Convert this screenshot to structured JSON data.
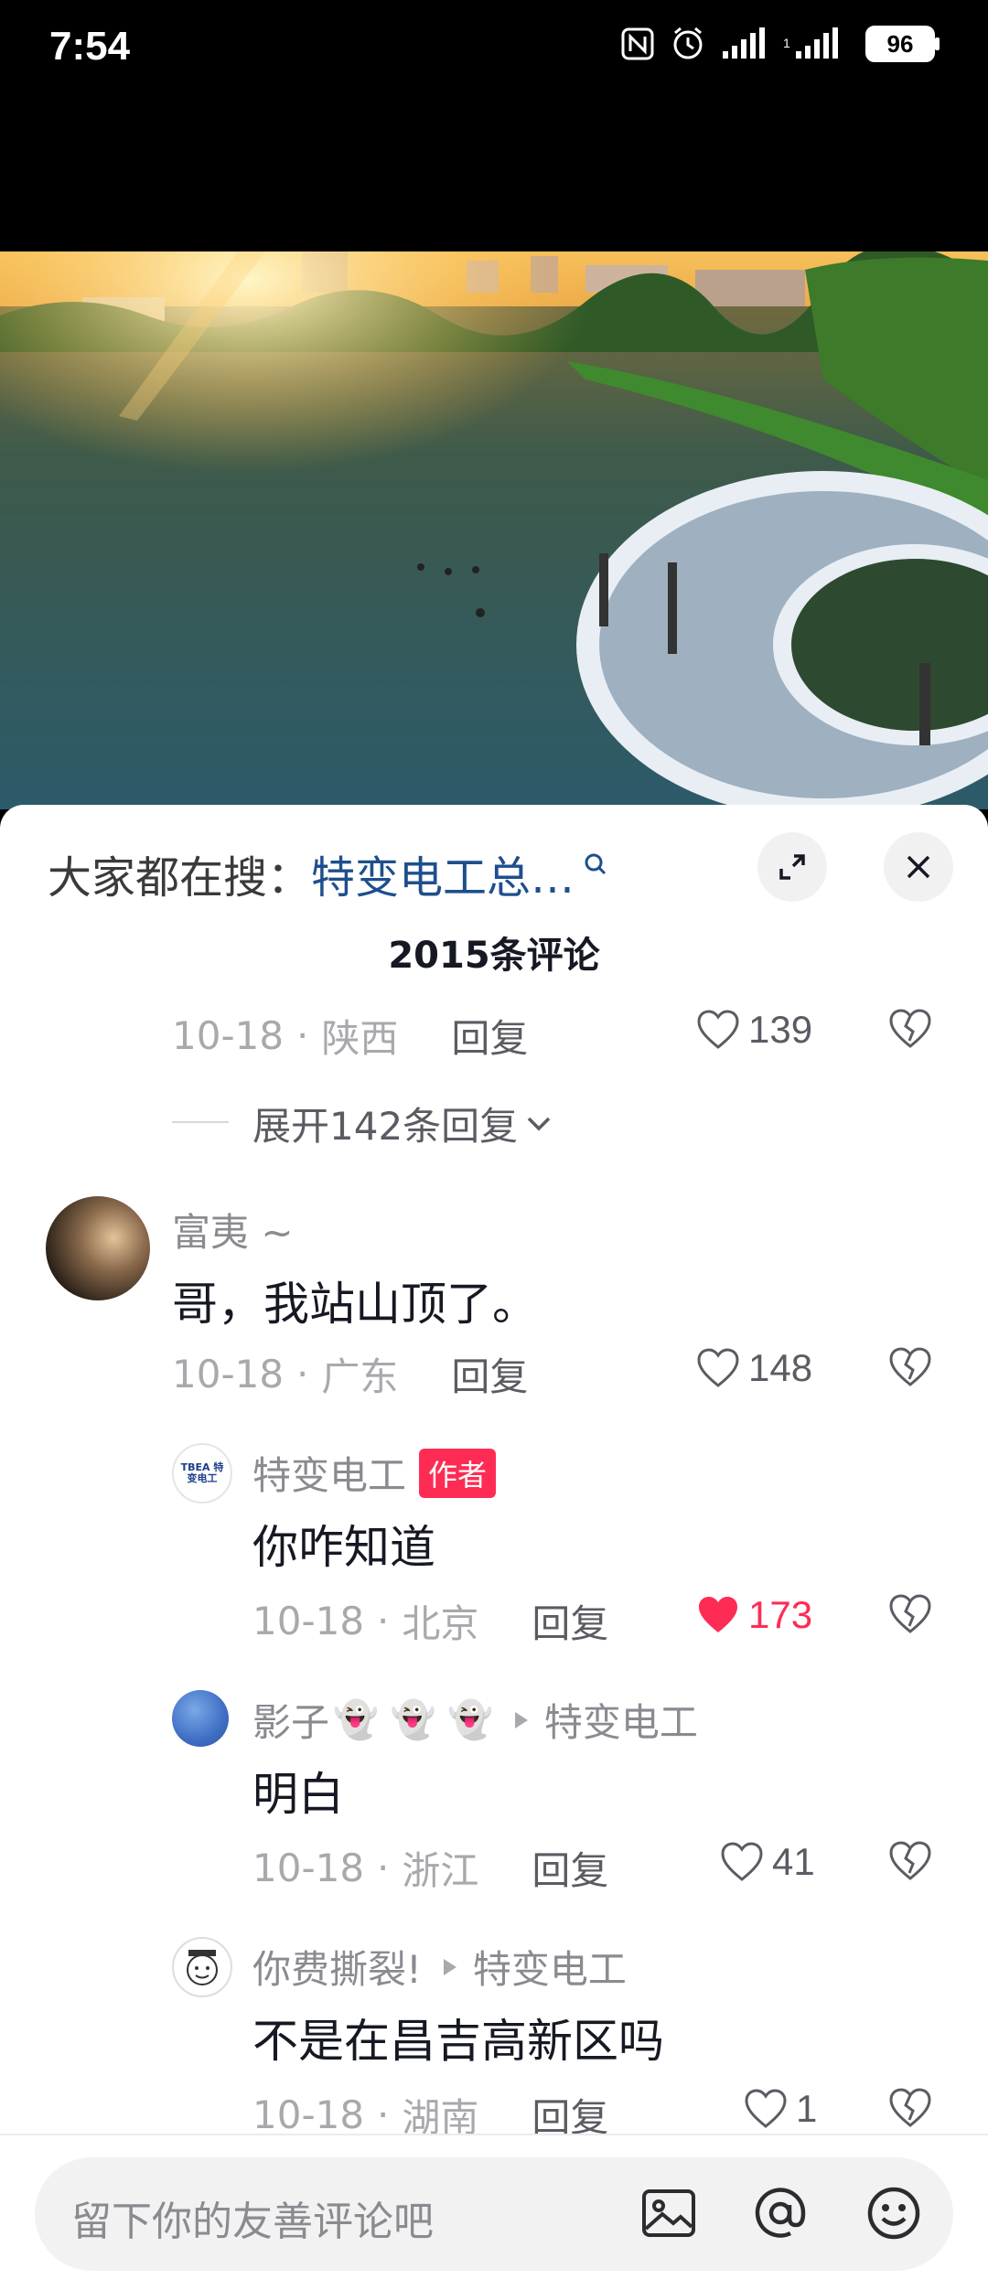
{
  "status": {
    "time": "7:54",
    "battery": "96"
  },
  "search": {
    "prefix": "大家都在搜：",
    "term": "特变电工总…"
  },
  "comments_count": "2015条评论",
  "thread0": {
    "date": "10-18",
    "location": "陕西",
    "reply": "回复",
    "likes": "139"
  },
  "expand": "展开142条回复",
  "comments": [
    {
      "name": "富夷 ~",
      "text": "哥，我站山顶了。",
      "date": "10-18",
      "location": "广东",
      "reply": "回复",
      "likes": "148"
    },
    {
      "name": "特变电工",
      "badge": "作者",
      "avatar_text": "TBEA 特变电工",
      "text": "你咋知道",
      "date": "10-18",
      "location": "北京",
      "reply": "回复",
      "likes": "173"
    },
    {
      "name": "影子",
      "ghosts": "👻 👻 👻",
      "reply_to": "特变电工",
      "text": "明白",
      "date": "10-18",
      "location": "浙江",
      "reply": "回复",
      "likes": "41"
    },
    {
      "name": "你费撕裂!",
      "reply_to": "特变电工",
      "text": "不是在昌吉高新区吗",
      "date": "10-18",
      "location": "湖南",
      "reply": "回复",
      "likes": "1"
    }
  ],
  "input": {
    "placeholder": "留下你的友善评论吧"
  },
  "colors": {
    "accent": "#fe2c55",
    "link": "#1e4f8c"
  },
  "icons": [
    "nfc-icon",
    "alarm-icon",
    "signal-icon",
    "battery-icon",
    "search-icon",
    "expand-icon",
    "close-icon",
    "heart-icon",
    "dislike-icon",
    "chevron-down-icon",
    "image-icon",
    "at-icon",
    "emoji-icon"
  ]
}
